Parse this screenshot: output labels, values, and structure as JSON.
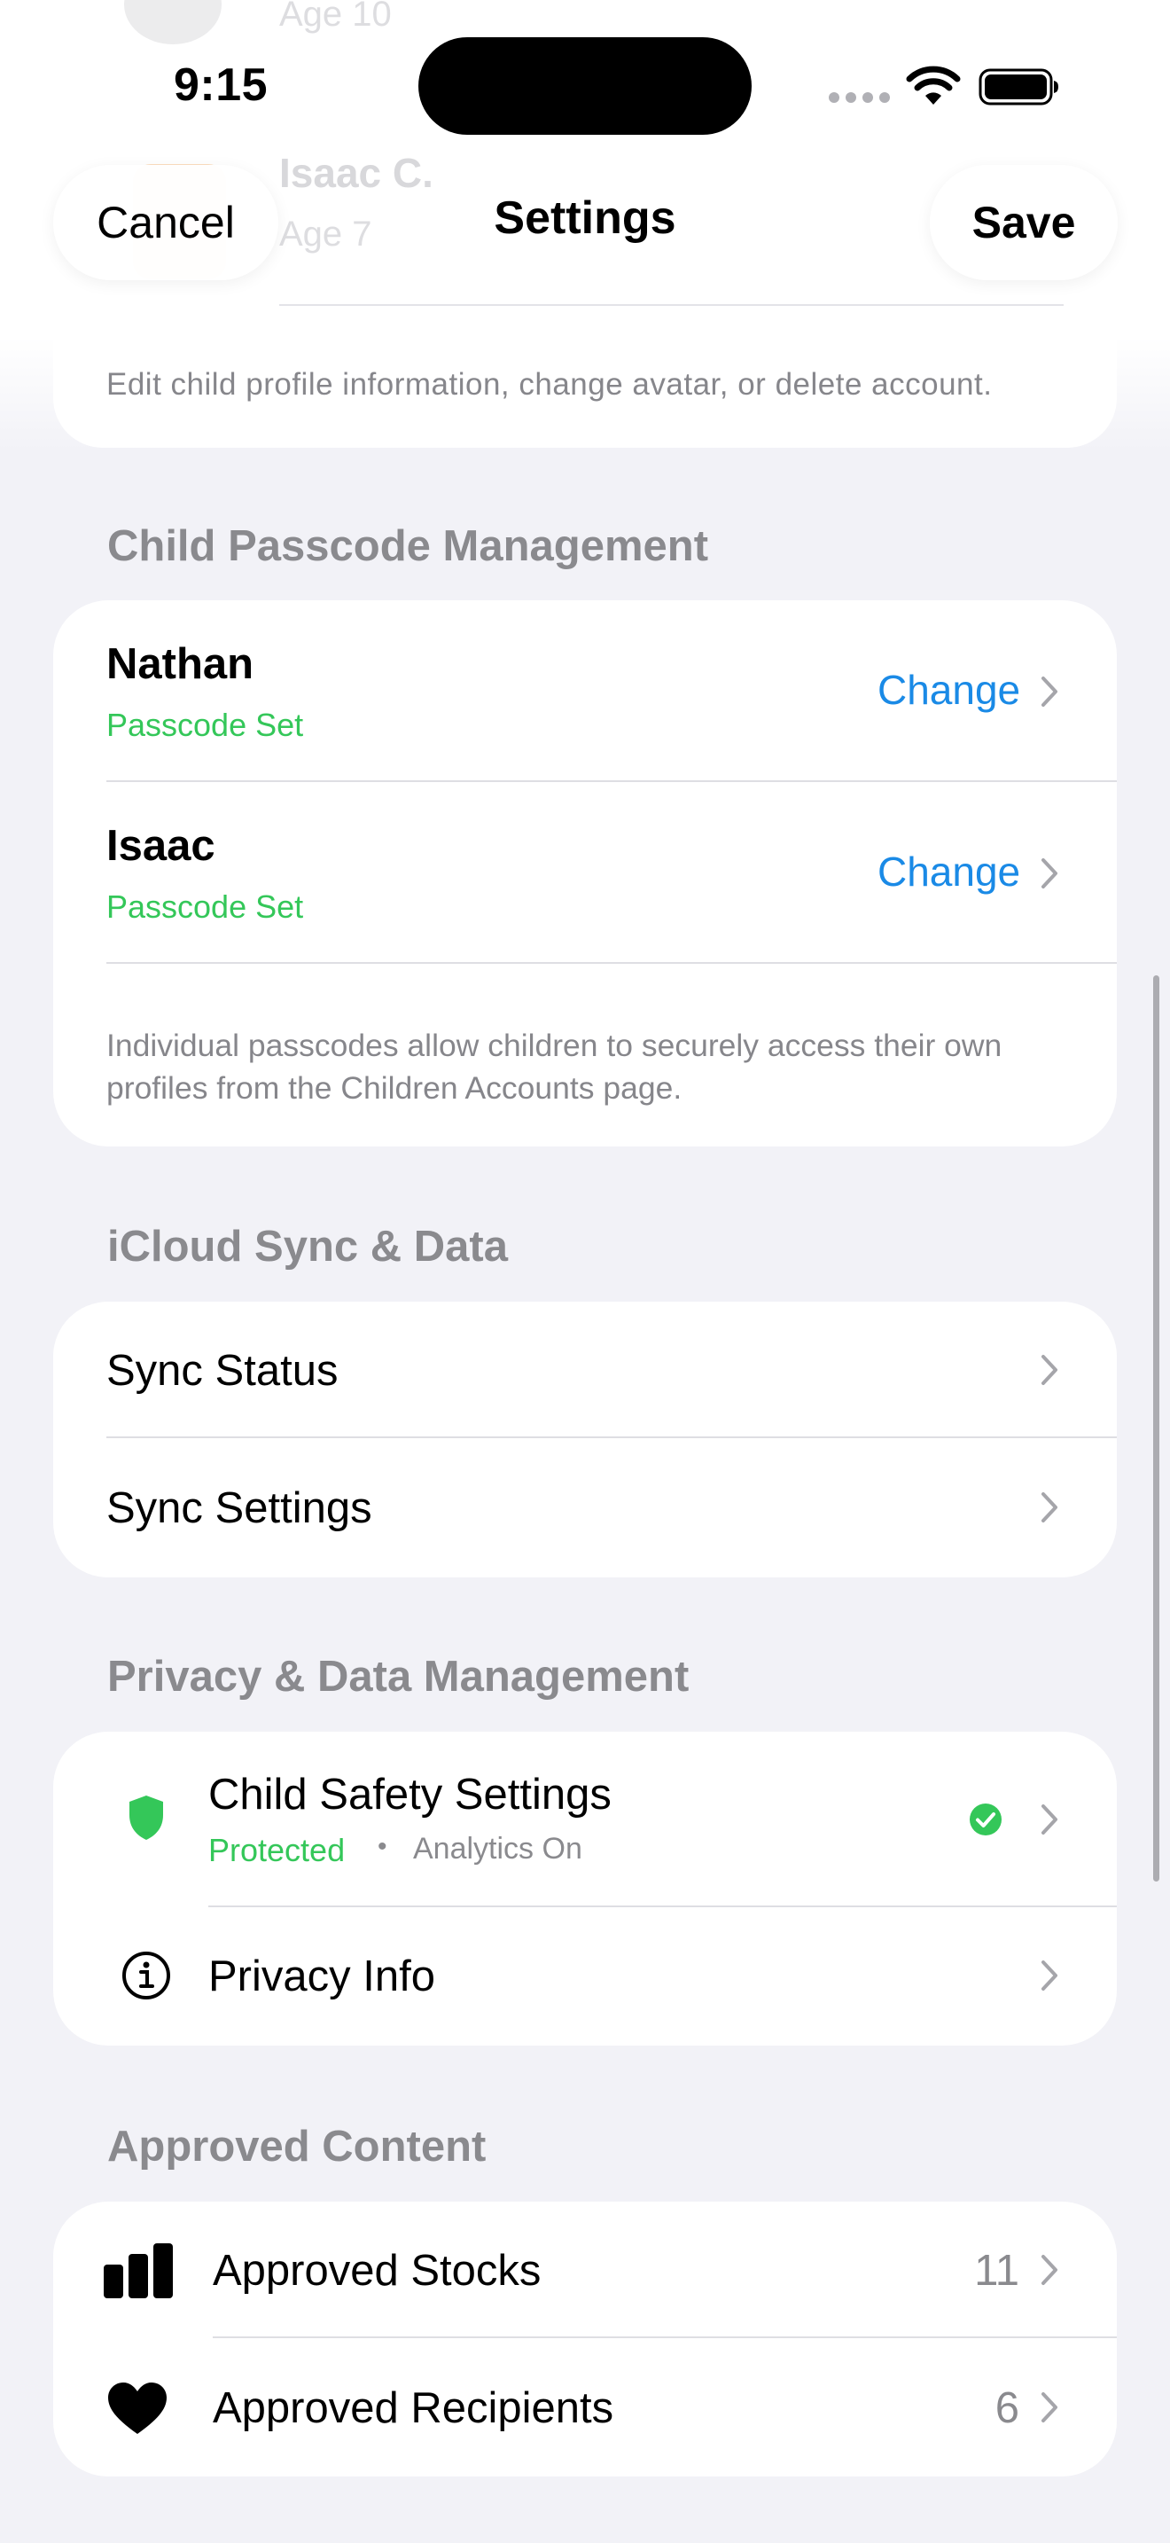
{
  "status_bar": {
    "time": "9:15"
  },
  "nav": {
    "cancel_label": "Cancel",
    "title": "Settings",
    "save_label": "Save"
  },
  "children_accounts": {
    "partial_age_top": "Age 10",
    "partial_child_name": "Isaac C.",
    "partial_child_age": "Age 7",
    "footer": "Edit child profile information, change avatar, or delete account."
  },
  "passcode_section": {
    "header": "Child Passcode Management",
    "rows": [
      {
        "name": "Nathan",
        "status": "Passcode Set",
        "action": "Change"
      },
      {
        "name": "Isaac",
        "status": "Passcode Set",
        "action": "Change"
      }
    ],
    "footnote": "Individual passcodes allow children to securely access their own profiles from the Children Accounts page."
  },
  "icloud_section": {
    "header": "iCloud Sync & Data",
    "rows": [
      {
        "label": "Sync Status"
      },
      {
        "label": "Sync Settings"
      }
    ]
  },
  "privacy_section": {
    "header": "Privacy & Data Management",
    "safety": {
      "label": "Child Safety Settings",
      "status": "Protected",
      "separator": "•",
      "analytics": "Analytics On",
      "icon": "shield-icon"
    },
    "privacy_info": {
      "label": "Privacy Info",
      "icon": "info-circle-icon"
    }
  },
  "approved_section": {
    "header": "Approved Content",
    "rows": [
      {
        "label": "Approved Stocks",
        "count": "11",
        "icon": "bar-chart-icon"
      },
      {
        "label": "Approved Recipients",
        "count": "6",
        "icon": "heart-icon"
      }
    ]
  },
  "colors": {
    "accent_blue": "#1a8ae6",
    "success_green": "#34c759",
    "secondary_gray": "#8a8a8e",
    "background": "#f2f2f7"
  }
}
